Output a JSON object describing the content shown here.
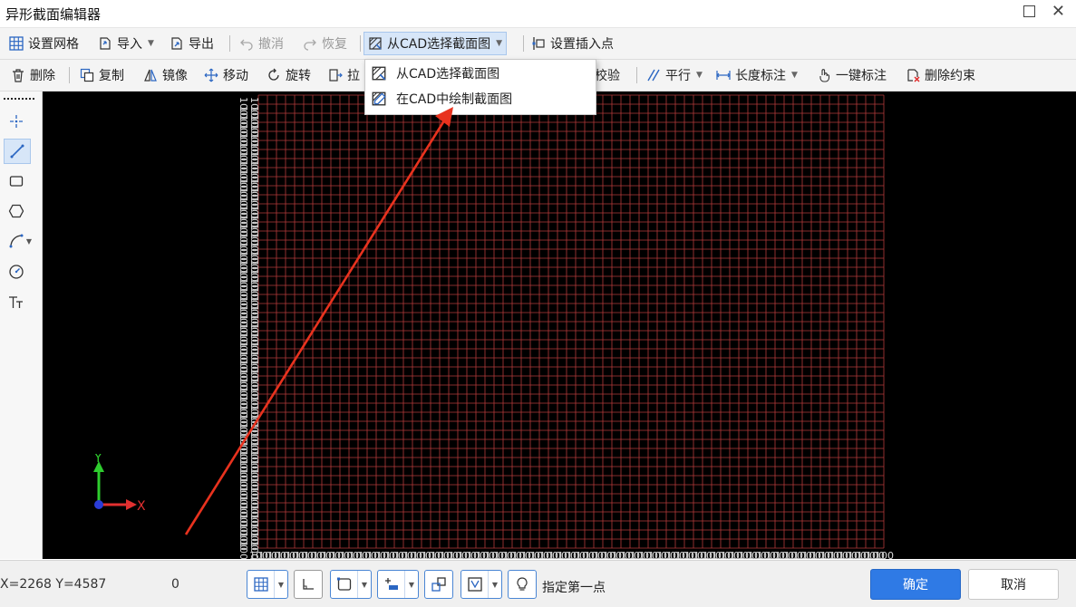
{
  "window": {
    "title": "异形截面编辑器"
  },
  "toolbar1": {
    "set_grid": "设置网格",
    "import": "导入",
    "export": "导出",
    "undo": "撤消",
    "redo": "恢复",
    "select_from_cad": "从CAD选择截面图",
    "set_insert_point": "设置插入点"
  },
  "toolbar2": {
    "delete": "删除",
    "copy": "复制",
    "mirror": "镜像",
    "move": "移动",
    "rotate": "旋转",
    "stretch": "拉",
    "check": "校验",
    "parallel": "平行",
    "length_dim": "长度标注",
    "one_key_dim": "一键标注",
    "delete_constraint": "删除约束"
  },
  "dropdown": {
    "items": [
      "从CAD选择截面图",
      "在CAD中绘制截面图"
    ]
  },
  "canvas": {
    "axis_x": "X",
    "axis_y": "Y",
    "grid_color": "#b23a3a",
    "label_color": "#d8d8d8",
    "y_label": "100",
    "x_label": "100",
    "annotation_color": "#e8321e"
  },
  "status": {
    "coords": "X=2268 Y=4587",
    "value": "0",
    "prompt": "指定第一点",
    "ok": "确定",
    "cancel": "取消"
  },
  "colors": {
    "accent": "#2f7ae5"
  }
}
